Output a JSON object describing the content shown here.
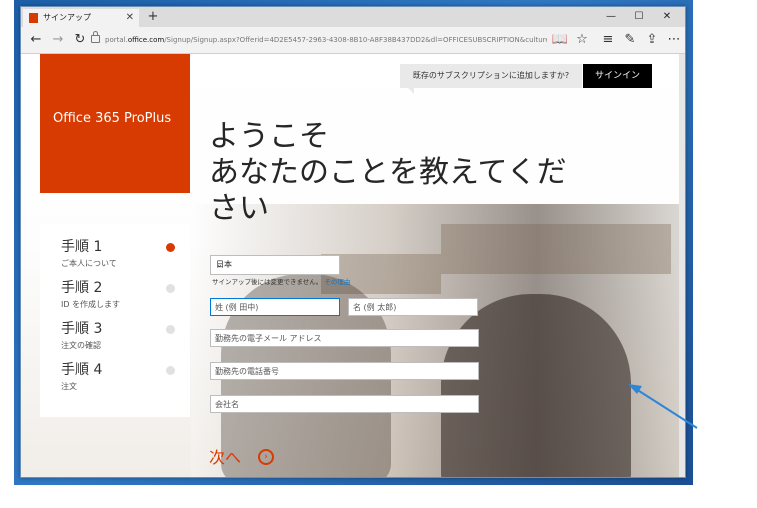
{
  "tab": {
    "title": "サインアップ"
  },
  "address_bar": {
    "domain_prefix": "portal.",
    "domain": "office.com",
    "path": "/Signup/Signup.aspx?Offerid=4D2E5457-2963-4308-8B10-A8F38B437DD2&dl=OFFICESUBSCRIPTION&culture=ja-JP&country=JP"
  },
  "brand": {
    "name": "Office 365 ProPlus",
    "color": "#d83b01"
  },
  "header": {
    "tip": "既存のサブスクリプションに追加しますか?",
    "signin_label": "サインイン"
  },
  "welcome": {
    "line1": "ようこそ",
    "line2": "あなたのことを教えてくだ",
    "line3": "さい"
  },
  "steps": [
    {
      "title": "手順 1",
      "subtitle": "ご本人について",
      "active": true
    },
    {
      "title": "手順 2",
      "subtitle": "ID を作成します",
      "active": false
    },
    {
      "title": "手順 3",
      "subtitle": "注文の確認",
      "active": false
    },
    {
      "title": "手順 4",
      "subtitle": "注文",
      "active": false
    }
  ],
  "form": {
    "country": "日本",
    "country_note": "サインアップ後には変更できません。",
    "country_note_link": "その理由",
    "last_name_placeholder": "姓 (例 田中)",
    "first_name_placeholder": "名 (例 太郎)",
    "email_placeholder": "勤務先の電子メール アドレス",
    "phone_placeholder": "勤務先の電話番号",
    "company_placeholder": "会社名",
    "next_label": "次へ"
  },
  "accent_arrow_color": "#2e86d6"
}
